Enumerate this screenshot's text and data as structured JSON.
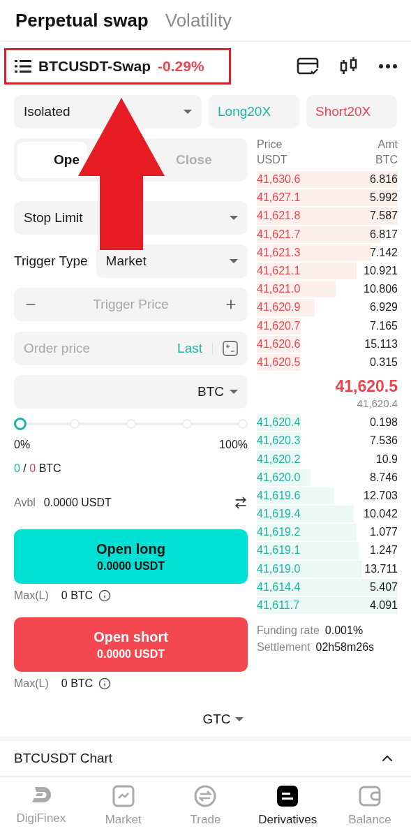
{
  "header_tabs": [
    {
      "label": "Perpetual swap",
      "selected": true
    },
    {
      "label": "Volatility",
      "selected": false
    }
  ],
  "symbol": {
    "name": "BTCUSDT-Swap",
    "change": "-0.29%",
    "highlighted": true
  },
  "annotation_arrow": true,
  "margin_mode": "Isolated",
  "leverage": [
    {
      "label": "Long20X",
      "kind": "long"
    },
    {
      "label": "Short20X",
      "kind": "short"
    }
  ],
  "order_tabs": [
    {
      "label": "Ope",
      "selected": true
    },
    {
      "label": "Close",
      "selected": false
    }
  ],
  "order_type": "Stop Limit",
  "trigger_type": {
    "label": "Trigger Type",
    "value": "Market"
  },
  "trigger_price": {
    "placeholder": "Trigger Price"
  },
  "order_price": {
    "placeholder": "Order price",
    "last": "Last"
  },
  "amount": {
    "unit": "BTC"
  },
  "slider": {
    "level": 0,
    "min_label": "0%",
    "max_label": "100%"
  },
  "position": {
    "long": "0",
    "separator": "/",
    "short": "0",
    "unit": "BTC"
  },
  "available": {
    "label": "Avbl",
    "value": "0.0000 USDT"
  },
  "actions": [
    {
      "kind": "long",
      "label": "Open long",
      "amount": "0.0000 USDT",
      "max_label": "Max(L)",
      "max_value": "0 BTC"
    },
    {
      "kind": "short",
      "label": "Open short",
      "amount": "0.0000 USDT",
      "max_label": "Max(L)",
      "max_value": "0 BTC"
    }
  ],
  "time_in_force": "GTC",
  "order_book": {
    "price_label": "Price",
    "price_unit": "USDT",
    "amount_label": "Amt",
    "amount_unit": "BTC",
    "asks": [
      {
        "price": "41,630.6",
        "amount": "6.816"
      },
      {
        "price": "41,627.1",
        "amount": "5.992"
      },
      {
        "price": "41,621.8",
        "amount": "7.587"
      },
      {
        "price": "41,621.7",
        "amount": "6.817"
      },
      {
        "price": "41,621.3",
        "amount": "7.142"
      },
      {
        "price": "41,621.1",
        "amount": "10.921"
      },
      {
        "price": "41,621.0",
        "amount": "10.806"
      },
      {
        "price": "41,620.9",
        "amount": "6.929"
      },
      {
        "price": "41,620.7",
        "amount": "7.165"
      },
      {
        "price": "41,620.6",
        "amount": "15.113"
      },
      {
        "price": "41,620.5",
        "amount": "0.315"
      }
    ],
    "last_price": "41,620.5",
    "mark_price": "41,620.4",
    "bids": [
      {
        "price": "41,620.4",
        "amount": "0.198"
      },
      {
        "price": "41,620.3",
        "amount": "7.536"
      },
      {
        "price": "41,620.2",
        "amount": "10.9"
      },
      {
        "price": "41,620.0",
        "amount": "8.746"
      },
      {
        "price": "41,619.6",
        "amount": "12.703"
      },
      {
        "price": "41,619.4",
        "amount": "10.042"
      },
      {
        "price": "41,619.2",
        "amount": "1.077"
      },
      {
        "price": "41,619.1",
        "amount": "1.247"
      },
      {
        "price": "41,619.0",
        "amount": "13.711"
      },
      {
        "price": "41,614.4",
        "amount": "5.407"
      },
      {
        "price": "41,611.7",
        "amount": "4.091"
      }
    ],
    "funding": {
      "label": "Funding rate",
      "value": "0.001%"
    },
    "settlement": {
      "label": "Settlement",
      "value": "02h58m26s"
    }
  },
  "chart_section": {
    "title": "BTCUSDT Chart",
    "expanded": true
  },
  "nav": [
    {
      "label": "DigiFinex",
      "kind": "logo",
      "selected": false
    },
    {
      "label": "Market",
      "kind": "market",
      "selected": false
    },
    {
      "label": "Trade",
      "kind": "trade",
      "selected": false
    },
    {
      "label": "Derivatives",
      "kind": "derivatives",
      "selected": true
    },
    {
      "label": "Balance",
      "kind": "balance",
      "selected": false
    }
  ]
}
